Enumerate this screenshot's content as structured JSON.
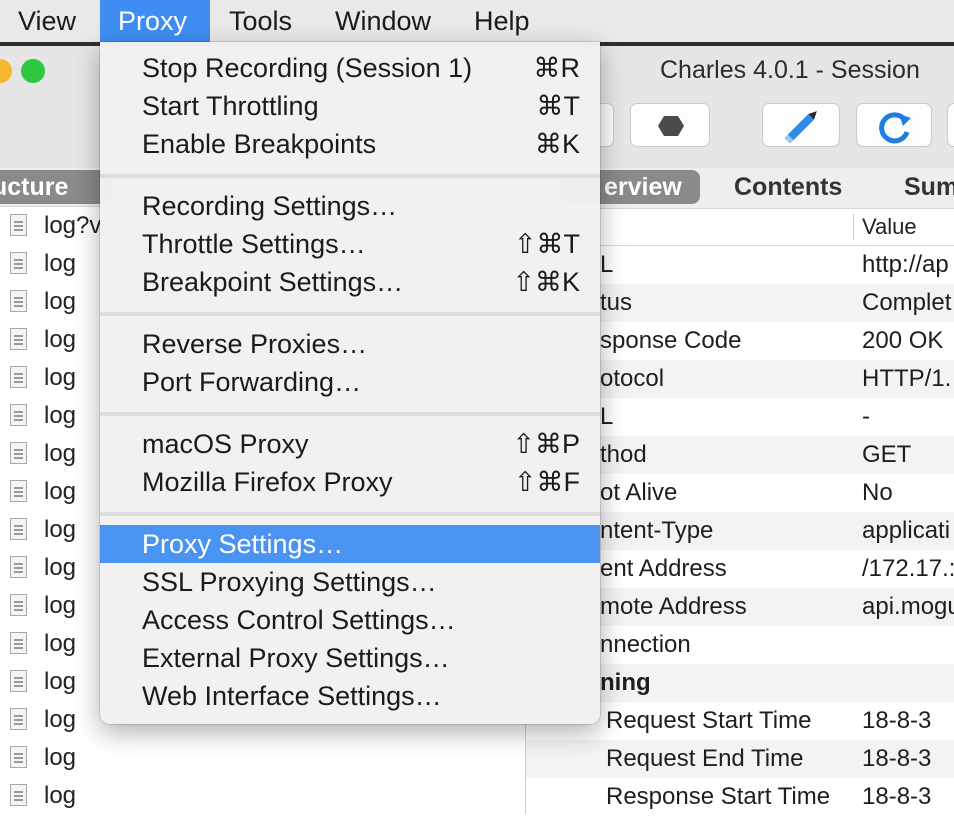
{
  "menubar": {
    "items": [
      {
        "label": "View"
      },
      {
        "label": "Proxy"
      },
      {
        "label": "Tools"
      },
      {
        "label": "Window"
      },
      {
        "label": "Help"
      }
    ],
    "active": "Proxy"
  },
  "proxy_menu": {
    "items": [
      {
        "label": "Stop Recording (Session 1)",
        "shortcut": "⌘R"
      },
      {
        "label": "Start Throttling",
        "shortcut": "⌘T"
      },
      {
        "label": "Enable Breakpoints",
        "shortcut": "⌘K"
      },
      {
        "label": "Recording Settings…",
        "shortcut": ""
      },
      {
        "label": "Throttle Settings…",
        "shortcut": "⇧⌘T"
      },
      {
        "label": "Breakpoint Settings…",
        "shortcut": "⇧⌘K"
      },
      {
        "label": "Reverse Proxies…",
        "shortcut": ""
      },
      {
        "label": "Port Forwarding…",
        "shortcut": ""
      },
      {
        "label": "macOS Proxy",
        "shortcut": "⇧⌘P"
      },
      {
        "label": "Mozilla Firefox Proxy",
        "shortcut": "⇧⌘F"
      },
      {
        "label": "Proxy Settings…",
        "shortcut": ""
      },
      {
        "label": "SSL Proxying Settings…",
        "shortcut": ""
      },
      {
        "label": "Access Control Settings…",
        "shortcut": ""
      },
      {
        "label": "External Proxy Settings…",
        "shortcut": ""
      },
      {
        "label": "Web Interface Settings…",
        "shortcut": ""
      }
    ],
    "highlighted": "Proxy Settings…"
  },
  "window": {
    "title": "Charles 4.0.1 - Session"
  },
  "structure": {
    "tab_label": "ucture",
    "rows": [
      "log?v",
      "log",
      "log",
      "log",
      "log",
      "log",
      "log",
      "log",
      "log",
      "log",
      "log",
      "log",
      "log",
      "log",
      "log",
      "log"
    ]
  },
  "detail": {
    "tabs": {
      "overview": "erview",
      "contents": "Contents",
      "summary": "Sum"
    },
    "value_header": "Value",
    "rows": [
      {
        "name": "L",
        "value": "http://ap"
      },
      {
        "name": "tus",
        "value": "Complet"
      },
      {
        "name": "sponse Code",
        "value": "200 OK"
      },
      {
        "name": "otocol",
        "value": "HTTP/1."
      },
      {
        "name": "L",
        "value": "-"
      },
      {
        "name": "thod",
        "value": "GET"
      },
      {
        "name": "ot Alive",
        "value": "No"
      },
      {
        "name": "ntent-Type",
        "value": "applicati"
      },
      {
        "name": "ent Address",
        "value": "/172.17.:"
      },
      {
        "name": "mote Address",
        "value": "api.mogu"
      },
      {
        "name": "nnection",
        "value": ""
      },
      {
        "name": "ning",
        "value": ""
      },
      {
        "name": "Request Start Time",
        "value": "18-8-3"
      },
      {
        "name": "Request End Time",
        "value": "18-8-3"
      },
      {
        "name": "Response Start Time",
        "value": "18-8-3"
      }
    ]
  },
  "colors": {
    "menubar_bg": "#e9e9e9",
    "menu_highlight": "#4a93f0",
    "tab_active": "#8a8a8a",
    "traffic_yellow": "#f6b72b",
    "traffic_green": "#2ec840",
    "refresh_blue": "#1d7ee0"
  }
}
